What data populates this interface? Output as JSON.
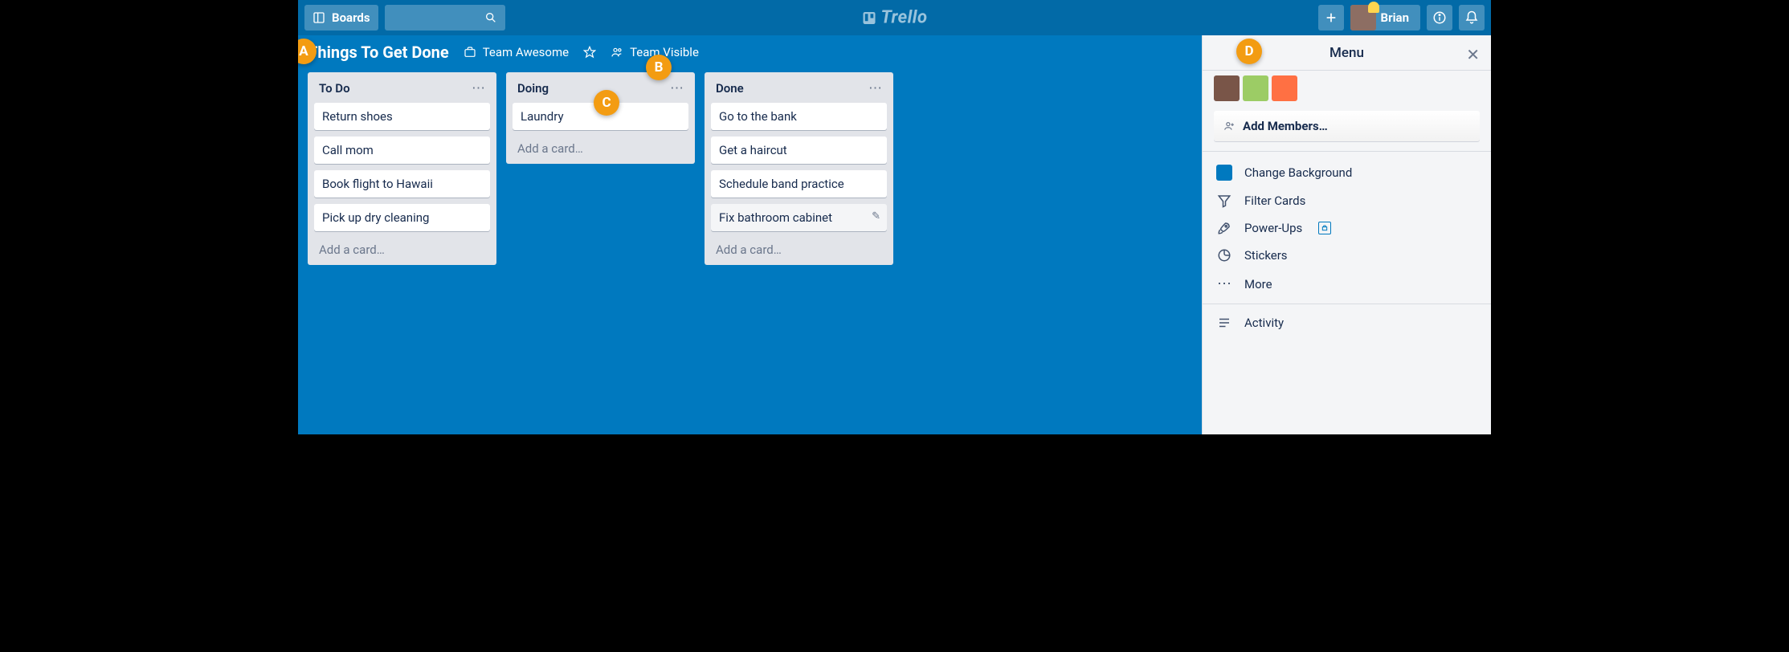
{
  "header": {
    "boards_label": "Boards",
    "search_placeholder": "",
    "logo_text": "Trello",
    "user_name": "Brian"
  },
  "board": {
    "title": "Things To Get Done",
    "team": "Team Awesome",
    "visibility": "Team Visible"
  },
  "callouts": {
    "a": "A",
    "b": "B",
    "c": "C",
    "d": "D"
  },
  "lists": [
    {
      "title": "To Do",
      "add_label": "Add a card…",
      "cards": [
        {
          "text": "Return shoes"
        },
        {
          "text": "Call mom"
        },
        {
          "text": "Book flight to Hawaii"
        },
        {
          "text": "Pick up dry cleaning"
        }
      ]
    },
    {
      "title": "Doing",
      "add_label": "Add a card…",
      "cards": [
        {
          "text": "Laundry"
        }
      ]
    },
    {
      "title": "Done",
      "add_label": "Add a card…",
      "cards": [
        {
          "text": "Go to the bank"
        },
        {
          "text": "Get a haircut"
        },
        {
          "text": "Schedule band practice"
        },
        {
          "text": "Fix bathroom cabinet",
          "hover": true
        }
      ]
    }
  ],
  "menu": {
    "title": "Menu",
    "add_members": "Add Members…",
    "items": {
      "change_bg": "Change Background",
      "filter": "Filter Cards",
      "powerups": "Power-Ups",
      "stickers": "Stickers",
      "more": "More",
      "activity": "Activity"
    }
  },
  "colors": {
    "brand": "#0079bf"
  }
}
